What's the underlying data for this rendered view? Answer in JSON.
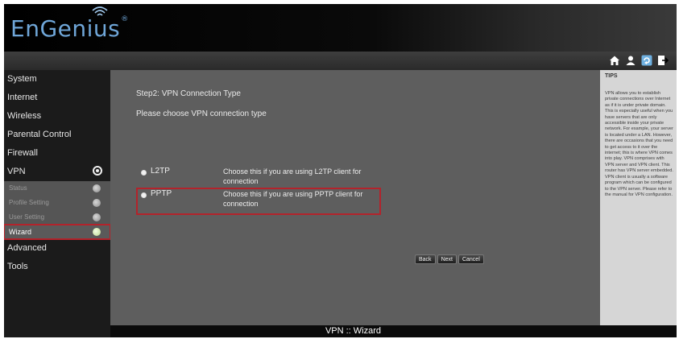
{
  "brand": {
    "logo_text": "EnGenius",
    "reg_mark": "®"
  },
  "toolbar": {
    "icons": [
      "home-icon",
      "user-icon",
      "refresh-icon",
      "logout-icon"
    ],
    "colors": {
      "home": "#ffffff",
      "user": "#ffffff",
      "refresh": "#6fb0e0",
      "logout": "#ffffff"
    }
  },
  "sidebar": {
    "items": [
      {
        "label": "System"
      },
      {
        "label": "Internet"
      },
      {
        "label": "Wireless"
      },
      {
        "label": "Parental Control"
      },
      {
        "label": "Firewall"
      },
      {
        "label": "VPN"
      }
    ],
    "vpn_submenu": [
      {
        "label": "Status"
      },
      {
        "label": "Profile Setting"
      },
      {
        "label": "User Setting"
      },
      {
        "label": "Wizard",
        "active": true
      }
    ],
    "lower_items": [
      {
        "label": "Advanced"
      },
      {
        "label": "Tools"
      }
    ]
  },
  "main": {
    "step_title": "Step2: VPN Connection Type",
    "step_desc": "Please choose VPN connection type",
    "options": [
      {
        "label": "L2TP",
        "desc": "Choose this if you are using L2TP client for connection"
      },
      {
        "label": "PPTP",
        "desc": "Choose this if you are using PPTP client for connection",
        "selected": true
      }
    ],
    "buttons": {
      "back": "Back",
      "next": "Next",
      "cancel": "Cancel"
    }
  },
  "footer": {
    "title": "VPN :: Wizard"
  },
  "tips": {
    "title": "TIPS",
    "body": "VPN allows you to establish private connections over Internet as if it is under private domain. This is especially useful when you have servers that are only accessible inside your private network. For example, your server is located under a LAN. However, there are occasions that you need to get access to it over the internet; this is where VPN comes into play. VPN comprises with VPN server and VPN client. This router has VPN server embedded. VPN client is usually a software program which can be configured to the VPN server. Please refer to the manual for VPN configuration."
  },
  "colors": {
    "highlight": "#b3232b",
    "logo": "#6fa6d8",
    "main_bg": "#5e5e5e",
    "tips_bg": "#d6d6d6"
  }
}
